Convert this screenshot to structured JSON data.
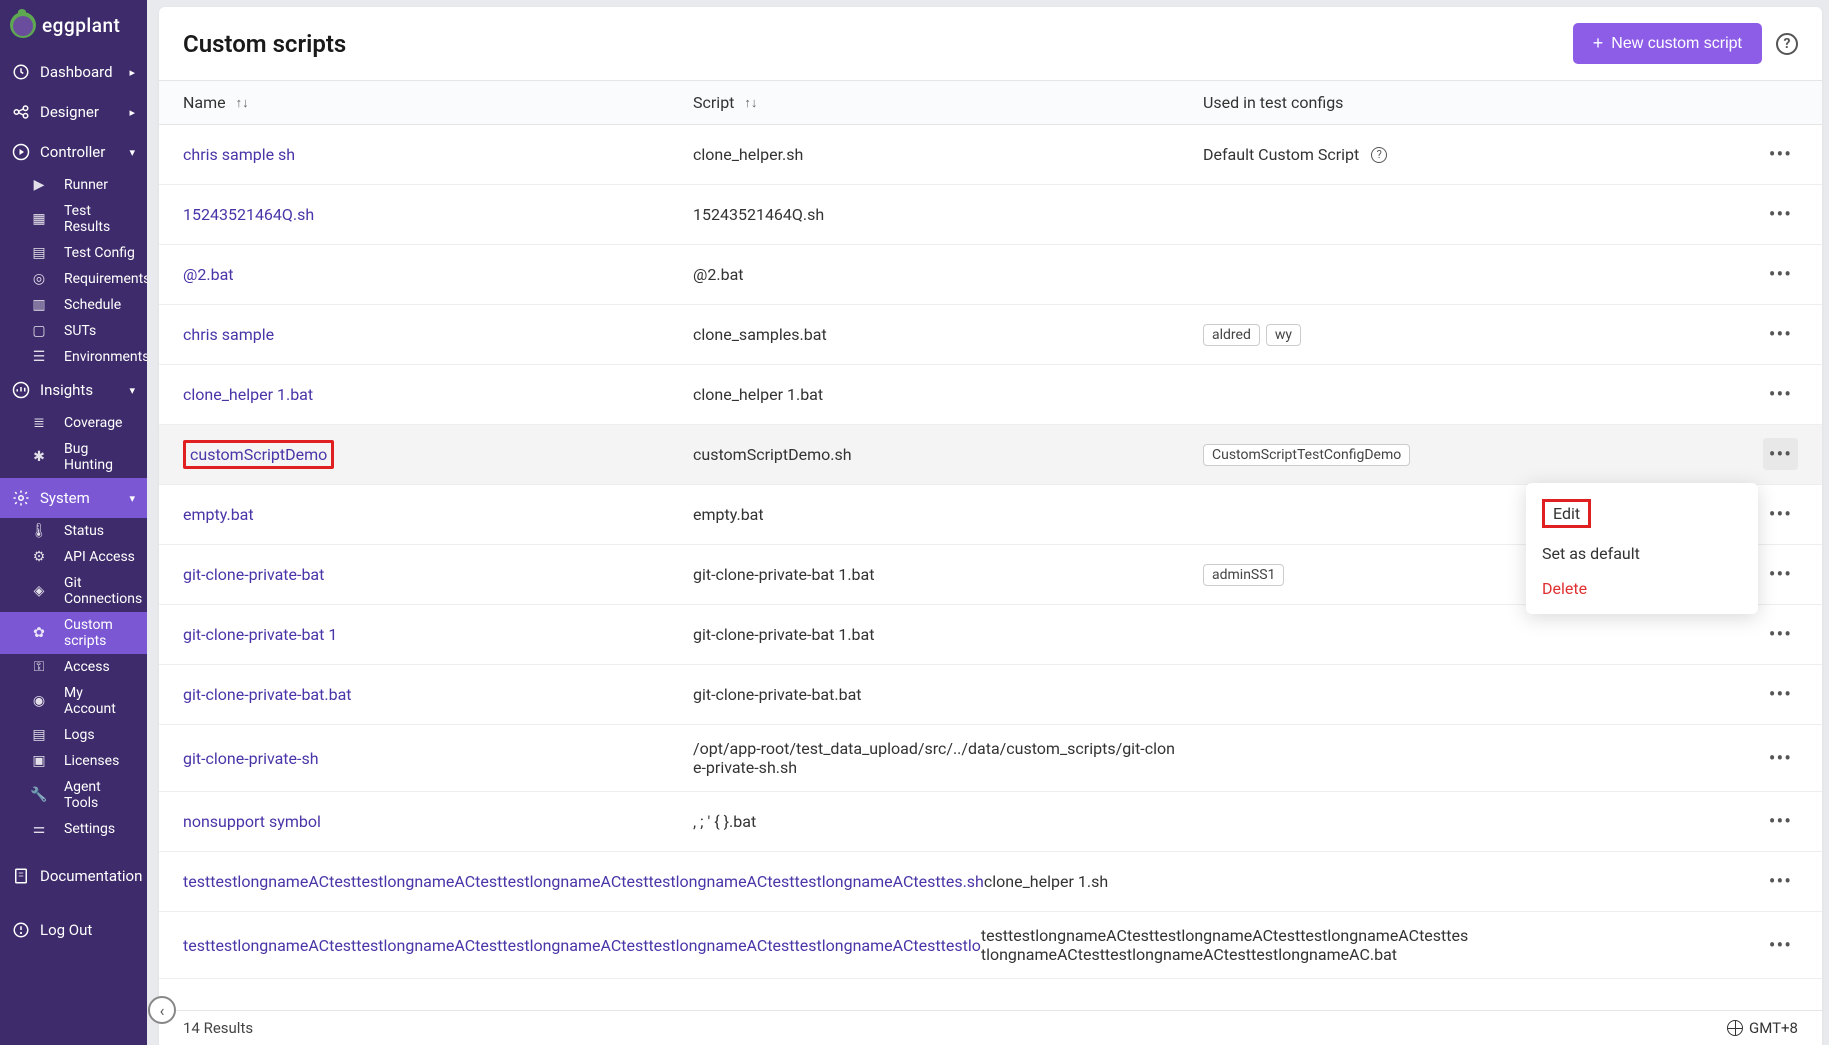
{
  "brand": "eggplant",
  "nav": {
    "dashboard": "Dashboard",
    "designer": "Designer",
    "controller": "Controller",
    "controller_items": {
      "runner": "Runner",
      "test_results": "Test Results",
      "test_config": "Test Config",
      "requirements": "Requirements",
      "schedule": "Schedule",
      "suts": "SUTs",
      "environments": "Environments"
    },
    "insights": "Insights",
    "insights_items": {
      "coverage": "Coverage",
      "bug_hunting": "Bug Hunting"
    },
    "system": "System",
    "system_items": {
      "status": "Status",
      "api_access": "API Access",
      "git_connections": "Git Connections",
      "custom_scripts": "Custom scripts",
      "access": "Access",
      "my_account": "My Account",
      "logs": "Logs",
      "licenses": "Licenses",
      "agent_tools": "Agent Tools",
      "settings": "Settings"
    },
    "documentation": "Documentation",
    "log_out": "Log Out"
  },
  "header": {
    "title": "Custom scripts",
    "new_button": "New custom script"
  },
  "columns": {
    "name": "Name",
    "script": "Script",
    "used": "Used in test configs"
  },
  "rows": [
    {
      "name": "chris sample sh",
      "script": "clone_helper.sh",
      "used_plain": "Default Custom Script",
      "info": true
    },
    {
      "name": "15243521464Q.sh",
      "script": "15243521464Q.sh"
    },
    {
      "name": "@2.bat",
      "script": "@2.bat"
    },
    {
      "name": "chris sample",
      "script": "clone_samples.bat",
      "tags": [
        "aldred",
        "wy"
      ]
    },
    {
      "name": "clone_helper 1.bat",
      "script": "clone_helper 1.bat"
    },
    {
      "name": "customScriptDemo",
      "script": "customScriptDemo.sh",
      "tags": [
        "CustomScriptTestConfigDemo"
      ],
      "highlighted": true,
      "name_boxed": true,
      "dots_active": true
    },
    {
      "name": "empty.bat",
      "script": "empty.bat"
    },
    {
      "name": "git-clone-private-bat",
      "script": "git-clone-private-bat 1.bat",
      "tags": [
        "adminSS1"
      ]
    },
    {
      "name": "git-clone-private-bat 1",
      "script": "git-clone-private-bat 1.bat"
    },
    {
      "name": "git-clone-private-bat.bat",
      "script": "git-clone-private-bat.bat"
    },
    {
      "name": "git-clone-private-sh",
      "script": "/opt/app-root/test_data_upload/src/../data/custom_scripts/git-clone-private-sh.sh"
    },
    {
      "name": "nonsupport symbol",
      "script": ", ; ' { }.bat"
    },
    {
      "name": "testtestlongnameACtesttestlongnameACtesttestlongnameACtesttestlongnameACtesttestlongnameACtesttes.sh",
      "script": "clone_helper 1.sh"
    },
    {
      "name": "testtestlongnameACtesttestlongnameACtesttestlongnameACtesttestlongnameACtesttestlongnameACtesttestlo",
      "script": "testtestlongnameACtesttestlongnameACtesttestlongnameACtesttestlongnameACtesttestlongnameACtesttestlongnameAC.bat"
    }
  ],
  "footer": {
    "results_count": "14",
    "results_label": " Results",
    "timezone": "GMT+8"
  },
  "dropdown": {
    "edit": "Edit",
    "set_default": "Set as default",
    "delete": "Delete"
  }
}
